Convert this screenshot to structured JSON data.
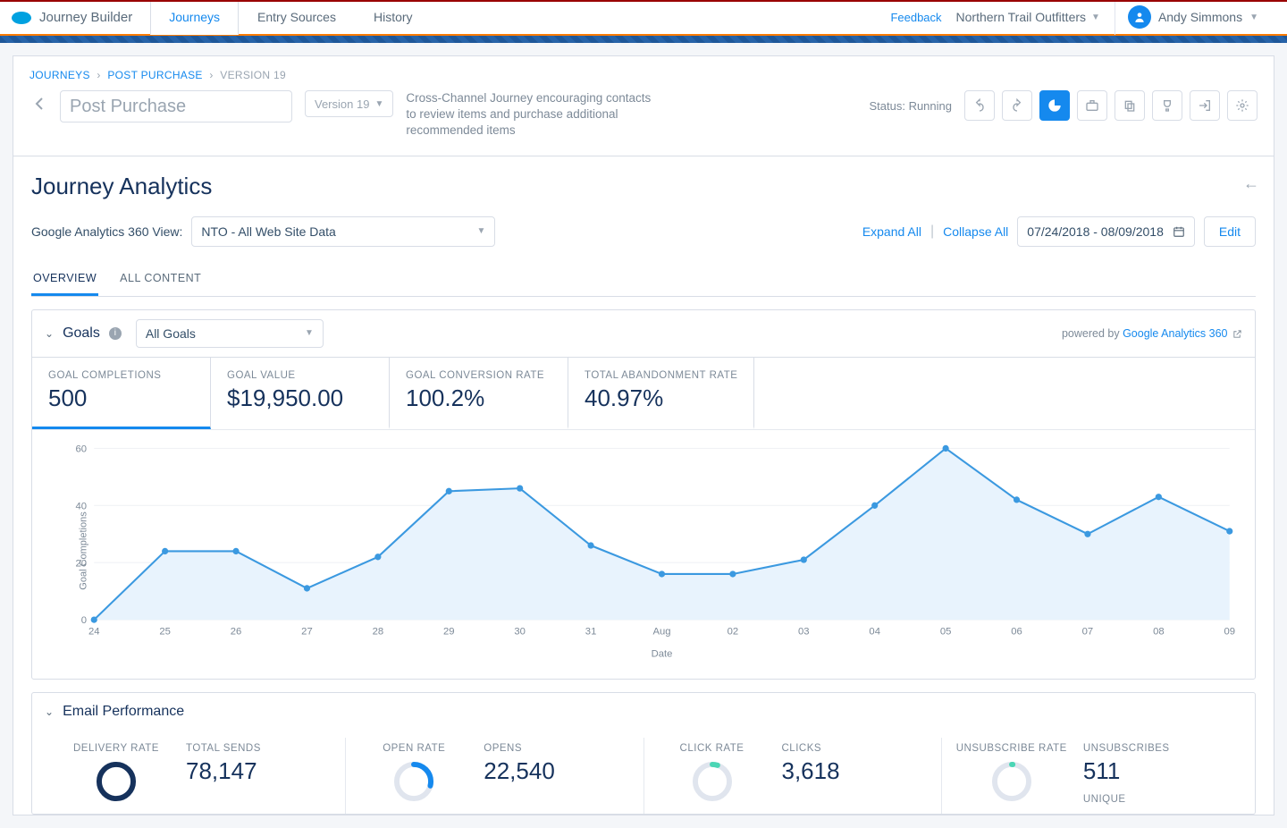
{
  "brand": {
    "name": "Journey Builder"
  },
  "nav": {
    "tabs": [
      "Journeys",
      "Entry Sources",
      "History"
    ],
    "active": 0,
    "feedback": "Feedback",
    "org": "Northern Trail Outfitters",
    "user": "Andy Simmons"
  },
  "breadcrumb": {
    "a": "JOURNEYS",
    "b": "POST PURCHASE",
    "c": "VERSION 19"
  },
  "journey": {
    "name": "Post Purchase",
    "version": "Version 19",
    "description": "Cross-Channel Journey encouraging contacts to review items and purchase additional recommended items",
    "status_label": "Status:",
    "status_value": "Running"
  },
  "analytics": {
    "title": "Journey Analytics",
    "ga_view_label": "Google Analytics 360 View:",
    "ga_view_value": "NTO - All Web Site Data",
    "expand": "Expand All",
    "collapse": "Collapse All",
    "date_range": "07/24/2018 - 08/09/2018",
    "edit": "Edit",
    "subtabs": [
      "OVERVIEW",
      "ALL CONTENT"
    ],
    "active_subtab": 0
  },
  "goals": {
    "title": "Goals",
    "select_value": "All Goals",
    "powered_prefix": "powered by ",
    "powered_link": "Google Analytics 360",
    "metrics": [
      {
        "label": "GOAL COMPLETIONS",
        "value": "500"
      },
      {
        "label": "GOAL VALUE",
        "value": "$19,950.00"
      },
      {
        "label": "GOAL CONVERSION RATE",
        "value": "100.2%"
      },
      {
        "label": "TOTAL ABANDONMENT RATE",
        "value": "40.97%"
      }
    ],
    "active_metric": 0
  },
  "chart_data": {
    "type": "line",
    "title": "",
    "ylabel": "Goal Completions",
    "xlabel": "Date",
    "ylim": [
      0,
      60
    ],
    "yticks": [
      0,
      20,
      40,
      60
    ],
    "categories": [
      "24",
      "25",
      "26",
      "27",
      "28",
      "29",
      "30",
      "31",
      "Aug",
      "02",
      "03",
      "04",
      "05",
      "06",
      "07",
      "08",
      "09"
    ],
    "values": [
      0,
      24,
      24,
      11,
      22,
      45,
      46,
      26,
      16,
      16,
      21,
      40,
      60,
      42,
      30,
      43,
      31
    ]
  },
  "email": {
    "title": "Email Performance",
    "cols": [
      {
        "gauge_label": "DELIVERY RATE",
        "gauge_pct": 100,
        "gauge_color": "#16325c",
        "num_label": "TOTAL SENDS",
        "num_value": "78,147"
      },
      {
        "gauge_label": "OPEN RATE",
        "gauge_pct": 29,
        "gauge_color": "#1589ee",
        "num_label": "OPENS",
        "num_value": "22,540"
      },
      {
        "gauge_label": "CLICK RATE",
        "gauge_pct": 5,
        "gauge_color": "#4bd6b5",
        "num_label": "CLICKS",
        "num_value": "3,618"
      },
      {
        "gauge_label": "UNSUBSCRIBE RATE",
        "gauge_pct": 1,
        "gauge_color": "#4bd6b5",
        "num_label": "UNSUBSCRIBES",
        "num_value": "511",
        "num_label2": "UNIQUE"
      }
    ]
  }
}
